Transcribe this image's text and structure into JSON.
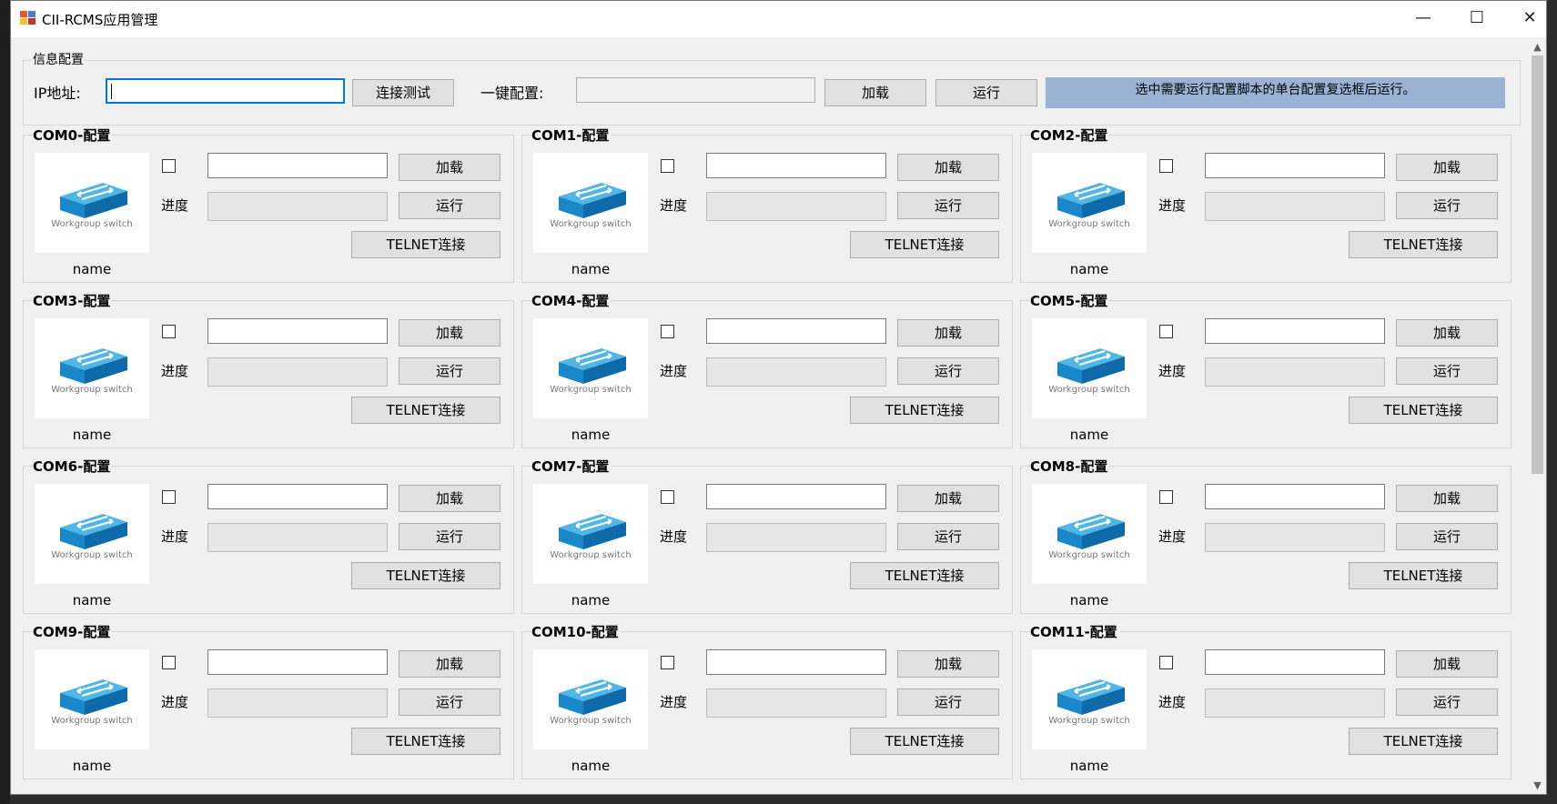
{
  "window": {
    "title": "CII-RCMS应用管理",
    "minimize_glyph": "—",
    "maximize_glyph": "☐",
    "close_glyph": "✕"
  },
  "info_config": {
    "legend": "信息配置",
    "ip_label": "IP地址:",
    "ip_value": "",
    "test_button": "连接测试",
    "oneclick_label": "一键配置:",
    "oneclick_value": "",
    "load_button": "加载",
    "run_button": "运行",
    "hint": "选中需要运行配置脚本的单台配置复选框后运行。"
  },
  "com_panels": [
    {
      "title": "COM0-配置",
      "name": "name",
      "progress_label": "进度",
      "load_button": "加载",
      "run_button": "运行",
      "telnet_button": "TELNET连接",
      "file_value": "",
      "checked": false,
      "progress": 0,
      "image_caption": "Workgroup switch"
    },
    {
      "title": "COM1-配置",
      "name": "name",
      "progress_label": "进度",
      "load_button": "加载",
      "run_button": "运行",
      "telnet_button": "TELNET连接",
      "file_value": "",
      "checked": false,
      "progress": 0,
      "image_caption": "Workgroup switch"
    },
    {
      "title": "COM2-配置",
      "name": "name",
      "progress_label": "进度",
      "load_button": "加载",
      "run_button": "运行",
      "telnet_button": "TELNET连接",
      "file_value": "",
      "checked": false,
      "progress": 0,
      "image_caption": "Workgroup switch"
    },
    {
      "title": "COM3-配置",
      "name": "name",
      "progress_label": "进度",
      "load_button": "加载",
      "run_button": "运行",
      "telnet_button": "TELNET连接",
      "file_value": "",
      "checked": false,
      "progress": 0,
      "image_caption": "Workgroup switch"
    },
    {
      "title": "COM4-配置",
      "name": "name",
      "progress_label": "进度",
      "load_button": "加载",
      "run_button": "运行",
      "telnet_button": "TELNET连接",
      "file_value": "",
      "checked": false,
      "progress": 0,
      "image_caption": "Workgroup switch"
    },
    {
      "title": "COM5-配置",
      "name": "name",
      "progress_label": "进度",
      "load_button": "加载",
      "run_button": "运行",
      "telnet_button": "TELNET连接",
      "file_value": "",
      "checked": false,
      "progress": 0,
      "image_caption": "Workgroup switch"
    },
    {
      "title": "COM6-配置",
      "name": "name",
      "progress_label": "进度",
      "load_button": "加载",
      "run_button": "运行",
      "telnet_button": "TELNET连接",
      "file_value": "",
      "checked": false,
      "progress": 0,
      "image_caption": "Workgroup switch"
    },
    {
      "title": "COM7-配置",
      "name": "name",
      "progress_label": "进度",
      "load_button": "加载",
      "run_button": "运行",
      "telnet_button": "TELNET连接",
      "file_value": "",
      "checked": false,
      "progress": 0,
      "image_caption": "Workgroup switch"
    },
    {
      "title": "COM8-配置",
      "name": "name",
      "progress_label": "进度",
      "load_button": "加载",
      "run_button": "运行",
      "telnet_button": "TELNET连接",
      "file_value": "",
      "checked": false,
      "progress": 0,
      "image_caption": "Workgroup switch"
    },
    {
      "title": "COM9-配置",
      "name": "name",
      "progress_label": "进度",
      "load_button": "加载",
      "run_button": "运行",
      "telnet_button": "TELNET连接",
      "file_value": "",
      "checked": false,
      "progress": 0,
      "image_caption": "Workgroup switch"
    },
    {
      "title": "COM10-配置",
      "name": "name",
      "progress_label": "进度",
      "load_button": "加载",
      "run_button": "运行",
      "telnet_button": "TELNET连接",
      "file_value": "",
      "checked": false,
      "progress": 0,
      "image_caption": "Workgroup switch"
    },
    {
      "title": "COM11-配置",
      "name": "name",
      "progress_label": "进度",
      "load_button": "加载",
      "run_button": "运行",
      "telnet_button": "TELNET连接",
      "file_value": "",
      "checked": false,
      "progress": 0,
      "image_caption": "Workgroup switch"
    }
  ],
  "colors": {
    "hint_bar": "#9ab3d5",
    "switch_blue": "#1a87c9",
    "focus_border": "#0078d7"
  },
  "icons": {
    "app": "app-grid-icon",
    "device": "workgroup-switch-icon"
  }
}
